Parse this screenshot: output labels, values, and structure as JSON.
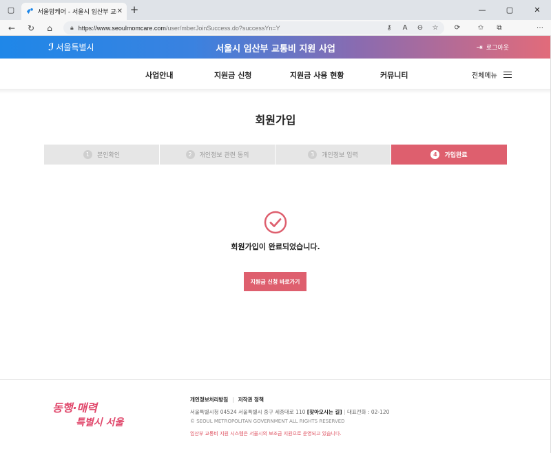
{
  "browser": {
    "tab_title": "서울맘케어 - 서울시 임산부 교통",
    "url_host": "https://www.seoulmomcare.com",
    "url_path": "/user/mberJoinSuccess.do?successYn=Y"
  },
  "header": {
    "logo_text": "서울특별시",
    "site_title": "서울시 임산부 교통비 지원 사업",
    "logout_label": "로그아웃"
  },
  "nav": {
    "items": [
      {
        "label": "사업안내"
      },
      {
        "label": "지원금 신청"
      },
      {
        "label": "지원금 사용 현황"
      },
      {
        "label": "커뮤니티"
      }
    ],
    "menu_all": "전체메뉴"
  },
  "page": {
    "title": "회원가입",
    "steps": [
      {
        "num": "1",
        "label": "본인확인"
      },
      {
        "num": "2",
        "label": "개인정보 관련 동의"
      },
      {
        "num": "3",
        "label": "개인정보 입력"
      },
      {
        "num": "4",
        "label": "가입완료"
      }
    ],
    "message": "회원가입이 완료되었습니다.",
    "button_label": "지원금 신청 바로가기"
  },
  "footer": {
    "link_privacy": "개인정보처리방침",
    "link_copyright": "저작권 정책",
    "address": "서울특별시청 04524 서울특별시 중구 세종대로 110",
    "directions": "[찾아오시는 길]",
    "phone": "대표전화 : 02-120",
    "copyright": "© SEOUL METROPOLITAN GOVERNMENT ALL RIGHTS RESERVED",
    "note": "임산부 교통비 지원 시스템은 서울시의 보조금 지원으로 운영되고 있습니다.",
    "slogan_line1": "동행·매력",
    "slogan_line2": "특별시 서울"
  },
  "colors": {
    "accent": "#de5f6e",
    "header_start": "#1f87e8",
    "header_end": "#e26b7a"
  }
}
